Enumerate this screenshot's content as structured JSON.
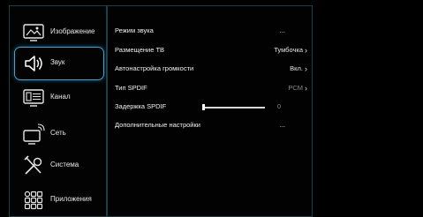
{
  "sidebar": {
    "items": [
      {
        "label": "Изображение",
        "icon": "picture-icon",
        "selected": false
      },
      {
        "label": "Звук",
        "icon": "speaker-icon",
        "selected": true
      },
      {
        "label": "Канал",
        "icon": "channel-list-icon",
        "selected": false
      },
      {
        "label": "Сеть",
        "icon": "network-icon",
        "selected": false
      },
      {
        "label": "Система",
        "icon": "tools-icon",
        "selected": false
      },
      {
        "label": "Приложения",
        "icon": "apps-grid-icon",
        "selected": false
      }
    ]
  },
  "sound_menu": {
    "rows": [
      {
        "label": "Режим звука",
        "value": "..."
      },
      {
        "label": "Размещение ТВ",
        "value": "Тумбочка",
        "chevron": true
      },
      {
        "label": "Автонастройка громкости",
        "value": "Вкл.",
        "chevron": true
      },
      {
        "label": "Тип SPDIF",
        "value": "PCM",
        "chevron": true,
        "dim": true
      },
      {
        "label": "Задержка SPDIF",
        "value": "0",
        "dim": true,
        "slider_level": 0
      },
      {
        "label": "Дополнительные настройки",
        "value": "..."
      }
    ]
  },
  "colors": {
    "accent": "#3aa7d9",
    "panel_border": "#1d3f4a",
    "background": "#000000"
  }
}
